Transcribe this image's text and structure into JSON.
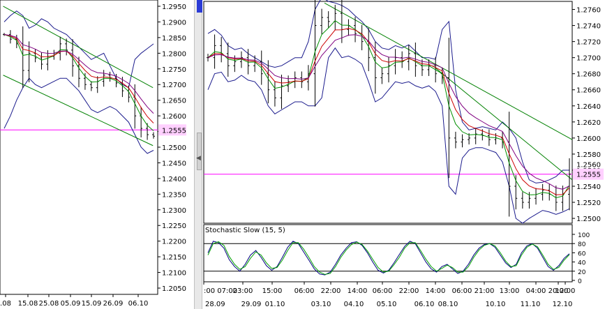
{
  "colors": {
    "background": "#ffffff",
    "grid": "#000000",
    "bollinger": "#1a1a8c",
    "price": "#000000",
    "ema_fast": "#009000",
    "ema_mid": "#cc0000",
    "ema_slow": "#800080",
    "trendline": "#008000",
    "hline": "#ff00ff",
    "stoch_k": "#000080",
    "stoch_d": "#00a000"
  },
  "left_chart": {
    "y_ticks": [
      "1.2950",
      "1.2900",
      "1.2850",
      "1.2800",
      "1.2750",
      "1.2700",
      "1.2650",
      "1.2600",
      "1.2550",
      "1.2500",
      "1.2450",
      "1.2400",
      "1.2350",
      "1.2300",
      "1.2250",
      "1.2200",
      "1.2150",
      "1.2100",
      "1.2050"
    ],
    "x_ticks": [
      ".08",
      "15.08",
      "25.08",
      "05.09",
      "15.09",
      "26.09",
      "06.10"
    ],
    "current_price": "1.2555"
  },
  "right_chart": {
    "y_ticks": [
      "1.2760",
      "1.2740",
      "1.2720",
      "1.2700",
      "1.2680",
      "1.2660",
      "1.2640",
      "1.2620",
      "1.2600",
      "1.2580",
      "1.2560",
      "1.2540",
      "1.2520",
      "1.2500"
    ],
    "x_time_ticks": [
      ":00 07:00",
      "23:00",
      "15:00",
      "06:00",
      "22:00",
      "14:00",
      "06:00",
      "22:00",
      "14:00",
      "06:00",
      "21:00",
      "13:00",
      "04:00",
      "20:00",
      "12:00"
    ],
    "x_date_ticks": [
      "28.09",
      "29.09",
      "01.10",
      "03.10",
      "04.10",
      "05.10",
      "06.10",
      "08.10",
      "10.10",
      "11.10",
      "12.10"
    ],
    "current_price": "1.2555",
    "partial_top_label": "1.2560"
  },
  "indicator": {
    "title": "Stochastic Slow (15, 5)",
    "y_ticks": [
      "100",
      "80",
      "60",
      "40",
      "20",
      "0"
    ]
  },
  "chart_data": [
    {
      "type": "line",
      "title": "",
      "ylim": [
        1.203,
        1.297
      ],
      "x_ticks": [
        ".08",
        "15.08",
        "25.08",
        "05.09",
        "15.09",
        "26.09",
        "06.10"
      ],
      "series": [
        {
          "values": [
            1.286,
            1.2845,
            1.283,
            1.2745,
            1.28,
            1.2785,
            1.2765,
            1.279,
            1.28,
            1.283,
            1.281,
            1.276,
            1.272,
            1.27,
            1.269,
            1.271,
            1.273,
            1.272,
            1.2705,
            1.268,
            1.266,
            1.26,
            1.256,
            1.254,
            1.2535
          ]
        }
      ],
      "bollinger_upper": [
        1.29,
        1.292,
        1.2935,
        1.292,
        1.288,
        1.289,
        1.291,
        1.29,
        1.288,
        1.287,
        1.286,
        1.284,
        1.282,
        1.28,
        1.278,
        1.279,
        1.28,
        1.276,
        1.272,
        1.27,
        1.269,
        1.278,
        1.28,
        1.2815,
        1.283
      ],
      "bollinger_lower": [
        1.256,
        1.26,
        1.265,
        1.269,
        1.272,
        1.27,
        1.269,
        1.27,
        1.271,
        1.272,
        1.272,
        1.27,
        1.268,
        1.265,
        1.262,
        1.261,
        1.262,
        1.263,
        1.262,
        1.26,
        1.258,
        1.254,
        1.25,
        1.248,
        1.249
      ],
      "trendlines": [
        [
          0.02,
          1.295,
          0.97,
          1.269
        ],
        [
          0.02,
          1.273,
          0.97,
          1.2505
        ]
      ],
      "hline": 1.2555
    },
    {
      "type": "line",
      "title": "",
      "ylim": [
        1.2494,
        1.277
      ],
      "x_time_ticks": [
        ":00 07:00",
        "23:00",
        "15:00",
        "06:00",
        "22:00",
        "14:00",
        "06:00",
        "22:00",
        "14:00",
        "06:00",
        "21:00",
        "13:00",
        "04:00",
        "20:00",
        "12:00"
      ],
      "x_date_ticks": [
        "28.09",
        "29.09",
        "01.10",
        "03.10",
        "04.10",
        "05.10",
        "06.10",
        "08.10",
        "10.10",
        "11.10",
        "12.10"
      ],
      "series": [
        {
          "values": [
            1.27,
            1.2715,
            1.2705,
            1.269,
            1.2695,
            1.27,
            1.269,
            1.2695,
            1.268,
            1.266,
            1.265,
            1.2665,
            1.267,
            1.2675,
            1.267,
            1.268,
            1.274,
            1.275,
            1.2745,
            1.2755,
            1.2735,
            1.274,
            1.273,
            1.272,
            1.27,
            1.2675,
            1.268,
            1.269,
            1.27,
            1.2695,
            1.2705,
            1.269,
            1.2685,
            1.269,
            1.268,
            1.2675,
            1.26,
            1.2595,
            1.2598,
            1.26,
            1.2605,
            1.2603,
            1.2598,
            1.26,
            1.2595,
            1.254,
            1.2525,
            1.252,
            1.2525,
            1.253,
            1.2535,
            1.253,
            1.252,
            1.253,
            1.2555
          ]
        }
      ],
      "bollinger_upper": [
        1.273,
        1.2735,
        1.2728,
        1.2715,
        1.271,
        1.2712,
        1.2705,
        1.27,
        1.2695,
        1.269,
        1.2688,
        1.269,
        1.2695,
        1.27,
        1.27,
        1.272,
        1.276,
        1.2775,
        1.277,
        1.2768,
        1.2765,
        1.276,
        1.2752,
        1.2745,
        1.2735,
        1.272,
        1.2712,
        1.271,
        1.2715,
        1.2712,
        1.2716,
        1.2708,
        1.27,
        1.27,
        1.2698,
        1.2735,
        1.2745,
        1.266,
        1.262,
        1.261,
        1.2612,
        1.2614,
        1.2612,
        1.261,
        1.262,
        1.2612,
        1.26,
        1.257,
        1.2548,
        1.2544,
        1.2545,
        1.2548,
        1.2552,
        1.256,
        1.256
      ],
      "bollinger_lower": [
        1.266,
        1.268,
        1.2682,
        1.267,
        1.2672,
        1.2678,
        1.2672,
        1.267,
        1.266,
        1.264,
        1.263,
        1.2635,
        1.264,
        1.2645,
        1.2645,
        1.264,
        1.264,
        1.265,
        1.27,
        1.2712,
        1.27,
        1.2702,
        1.2698,
        1.2692,
        1.267,
        1.2645,
        1.265,
        1.266,
        1.267,
        1.2668,
        1.267,
        1.2665,
        1.2662,
        1.2665,
        1.2658,
        1.264,
        1.254,
        1.253,
        1.2575,
        1.2585,
        1.2588,
        1.2588,
        1.2585,
        1.2582,
        1.257,
        1.254,
        1.25,
        1.2494,
        1.25,
        1.2505,
        1.251,
        1.2508,
        1.2505,
        1.2508,
        1.2512
      ],
      "trendlines": [
        [
          0.55,
          1.2705,
          0.99,
          1.2595
        ],
        [
          0.55,
          1.2662,
          0.99,
          1.2545
        ]
      ],
      "hline": 1.2555
    },
    {
      "type": "line",
      "title": "Stochastic Slow (15, 5)",
      "ylim": [
        0,
        100
      ],
      "y_ticks": [
        "100",
        "80",
        "60",
        "40",
        "20",
        "0"
      ],
      "reference_lines": [
        20,
        80
      ],
      "series": [
        {
          "values": [
            60,
            85,
            82,
            70,
            45,
            30,
            20,
            35,
            55,
            65,
            50,
            32,
            22,
            30,
            50,
            72,
            85,
            80,
            62,
            44,
            25,
            14,
            12,
            18,
            35,
            55,
            70,
            82,
            84,
            76,
            60,
            40,
            22,
            16,
            22,
            38,
            56,
            74,
            85,
            80,
            60,
            40,
            25,
            18,
            30,
            35,
            25,
            15,
            20,
            35,
            55,
            70,
            78,
            80,
            72,
            55,
            38,
            28,
            35,
            60,
            75,
            80,
            70,
            50,
            30,
            22,
            32,
            48,
            58
          ]
        },
        {
          "values": [
            55,
            80,
            84,
            76,
            52,
            35,
            24,
            30,
            48,
            62,
            55,
            38,
            26,
            28,
            44,
            65,
            82,
            82,
            68,
            50,
            30,
            18,
            13,
            15,
            30,
            50,
            66,
            78,
            83,
            78,
            64,
            46,
            28,
            18,
            20,
            34,
            50,
            70,
            82,
            82,
            65,
            46,
            30,
            20,
            26,
            33,
            28,
            18,
            18,
            30,
            50,
            66,
            76,
            80,
            75,
            60,
            42,
            30,
            32,
            55,
            72,
            79,
            73,
            55,
            35,
            24,
            28,
            44,
            56
          ]
        }
      ]
    }
  ]
}
